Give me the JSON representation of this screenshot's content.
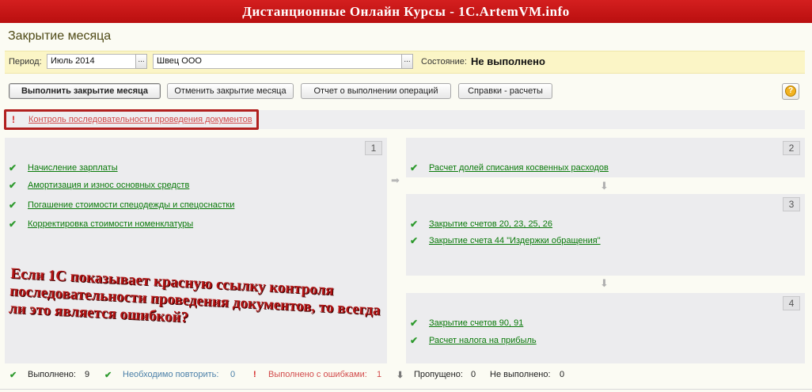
{
  "banner": {
    "title": "Дистанционные Онлайн Курсы - 1С.ArtemVM.info"
  },
  "form": {
    "title": "Закрытие месяца"
  },
  "period_bar": {
    "period_label": "Период:",
    "period_value": "Июль 2014",
    "organization_value": "Швец ООО",
    "select_button": "...",
    "state_label": "Состояние:",
    "state_value": "Не выполнено"
  },
  "toolbar": {
    "execute": "Выполнить закрытие месяца",
    "cancel": "Отменить закрытие месяца",
    "report": "Отчет о выполнении операций",
    "reference": "Справки - расчеты",
    "help": "?"
  },
  "control": {
    "mark": "!",
    "link": "Контроль последовательности проведения документов"
  },
  "panels": {
    "p1": {
      "number": "1",
      "items": [
        "Начисление зарплаты",
        "Амортизация и износ основных средств",
        "Погашение стоимости спецодежды и спецоснастки",
        "Корректировка стоимости номенклатуры"
      ]
    },
    "p2": {
      "number": "2",
      "items": [
        "Расчет долей списания косвенных расходов"
      ]
    },
    "p3": {
      "number": "3",
      "items": [
        "Закрытие счетов 20, 23, 25, 26",
        "Закрытие счета 44 \"Издержки обращения\""
      ]
    },
    "p4": {
      "number": "4",
      "items": [
        "Закрытие счетов 90, 91",
        "Расчет налога на прибыль"
      ]
    }
  },
  "overlay": {
    "text": "Если 1С показывает красную ссылку контроля последовательности проведения документов, то всегда ли это является ошибкой?"
  },
  "status": {
    "done_label": "Выполнено:",
    "done_count": "9",
    "repeat_label": "Необходимо повторить:",
    "repeat_count": "0",
    "errors_label": "Выполнено с ошибками:",
    "errors_count": "1",
    "skipped_label": "Пропущено:",
    "skipped_count": "0",
    "not_done_label": "Не выполнено:",
    "not_done_count": "0"
  },
  "colors": {
    "banner": "#c41818",
    "period_bar": "#fbf5c6",
    "link_green": "#0a7a0a",
    "link_red": "#d24b4b",
    "overlay_text": "#b41313"
  }
}
